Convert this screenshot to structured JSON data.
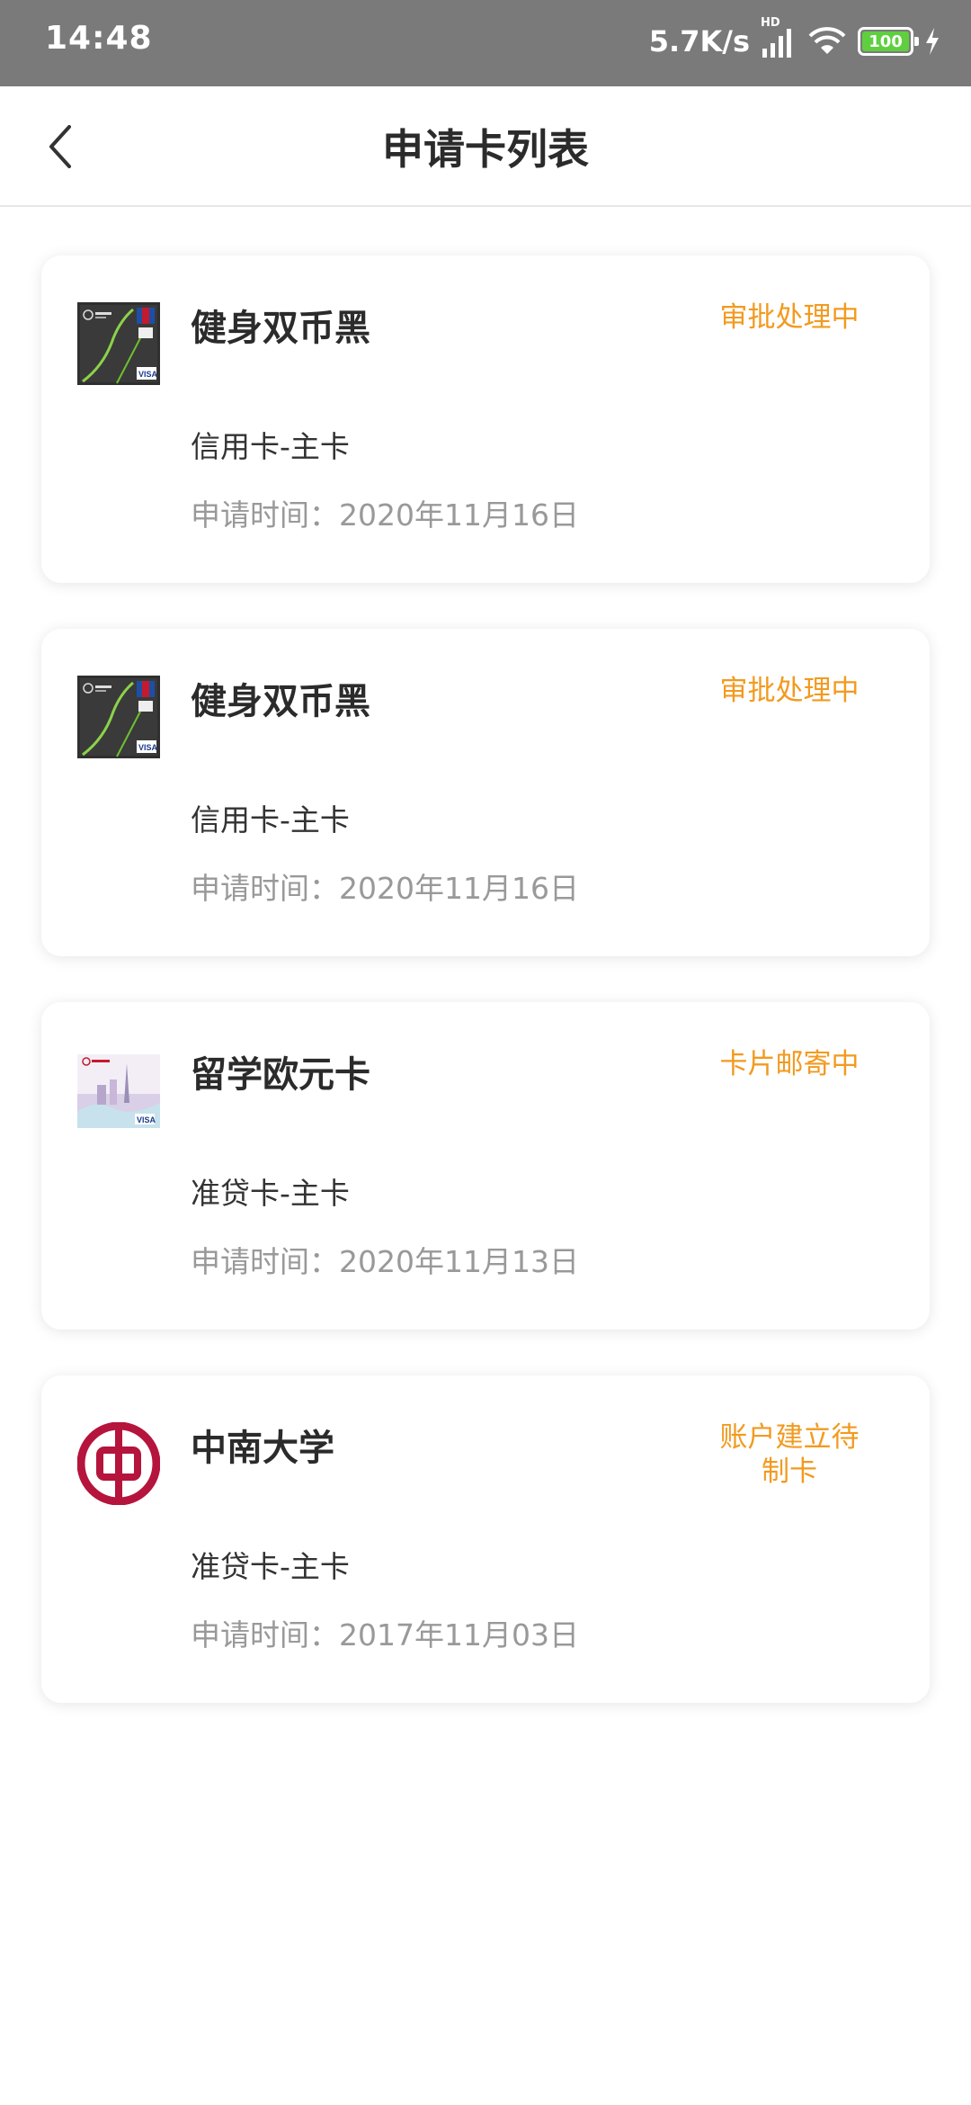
{
  "status_bar": {
    "time": "14:48",
    "net_speed": "5.7K/s",
    "hd": "HD",
    "battery": "100"
  },
  "nav": {
    "title": "申请卡列表"
  },
  "cards": [
    {
      "name": "健身双币黑",
      "status": "审批处理中",
      "type": "信用卡-主卡",
      "date_label": "申请时间：",
      "date": "2020年11月16日",
      "thumb": "fitness-card-image"
    },
    {
      "name": "健身双币黑",
      "status": "审批处理中",
      "type": "信用卡-主卡",
      "date_label": "申请时间：",
      "date": "2020年11月16日",
      "thumb": "fitness-card-image"
    },
    {
      "name": "留学欧元卡",
      "status": "卡片邮寄中",
      "type": "准贷卡-主卡",
      "date_label": "申请时间：",
      "date": "2020年11月13日",
      "thumb": "euro-study-card-image"
    },
    {
      "name": "中南大学",
      "status": "账户建立待制卡",
      "type": "准贷卡-主卡",
      "date_label": "申请时间：",
      "date": "2017年11月03日",
      "thumb": "bank-logo"
    }
  ],
  "colors": {
    "status_orange": "#f29a1f",
    "title_text": "#2b2b2b",
    "secondary_text": "#999999",
    "bank_red": "#b5143c"
  }
}
